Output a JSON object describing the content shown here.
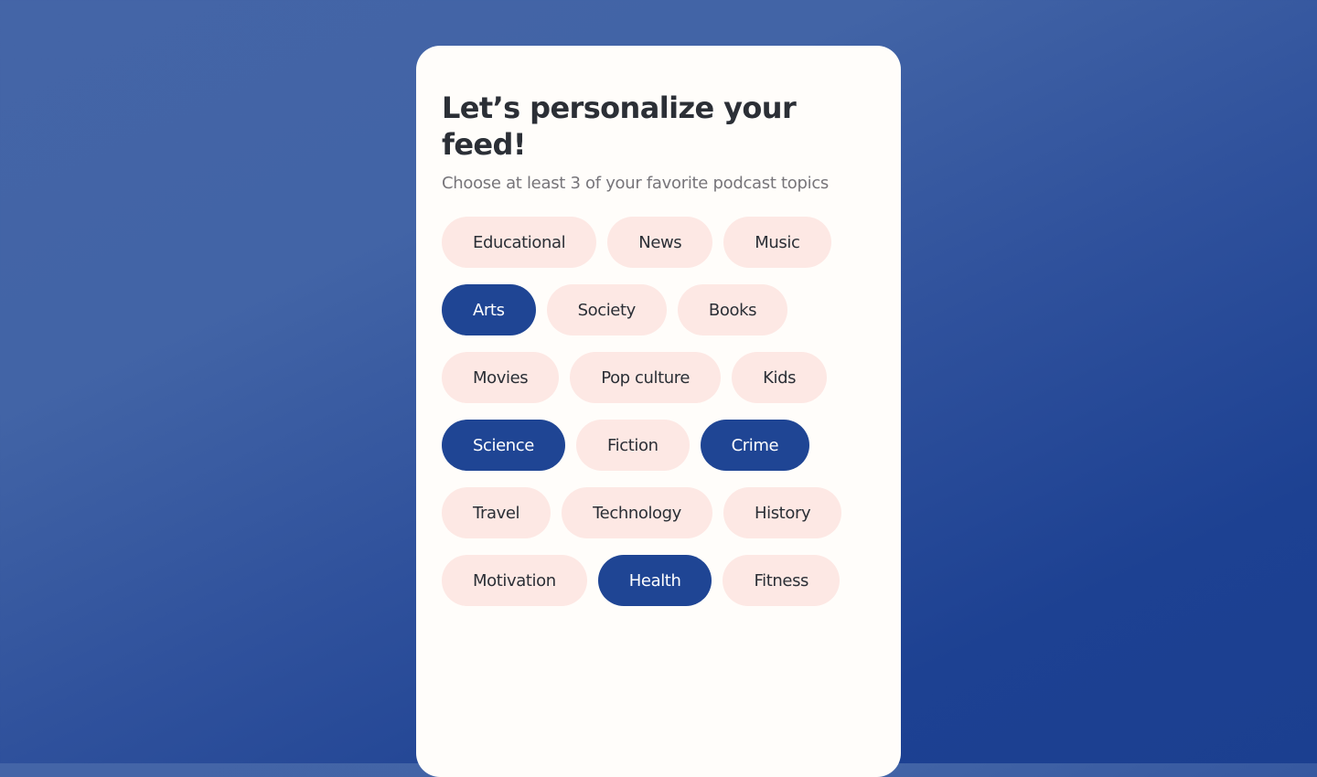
{
  "header": {
    "title": "Let’s personalize your feed!",
    "subtitle": "Choose at least 3 of your favorite podcast topics"
  },
  "colors": {
    "chip_default": "#fde8e4",
    "chip_selected": "#1f4594",
    "card_background": "#fffdfa",
    "title_text": "#2b2f36"
  },
  "topics": [
    {
      "label": "Educational",
      "selected": false
    },
    {
      "label": "News",
      "selected": false
    },
    {
      "label": "Music",
      "selected": false
    },
    {
      "label": "Arts",
      "selected": true
    },
    {
      "label": "Society",
      "selected": false
    },
    {
      "label": "Books",
      "selected": false
    },
    {
      "label": "Movies",
      "selected": false
    },
    {
      "label": "Pop culture",
      "selected": false
    },
    {
      "label": "Kids",
      "selected": false
    },
    {
      "label": "Science",
      "selected": true
    },
    {
      "label": "Fiction",
      "selected": false
    },
    {
      "label": "Crime",
      "selected": true
    },
    {
      "label": "Travel",
      "selected": false
    },
    {
      "label": "Technology",
      "selected": false
    },
    {
      "label": "History",
      "selected": false
    },
    {
      "label": "Motivation",
      "selected": false
    },
    {
      "label": "Health",
      "selected": true
    },
    {
      "label": "Fitness",
      "selected": false
    }
  ]
}
